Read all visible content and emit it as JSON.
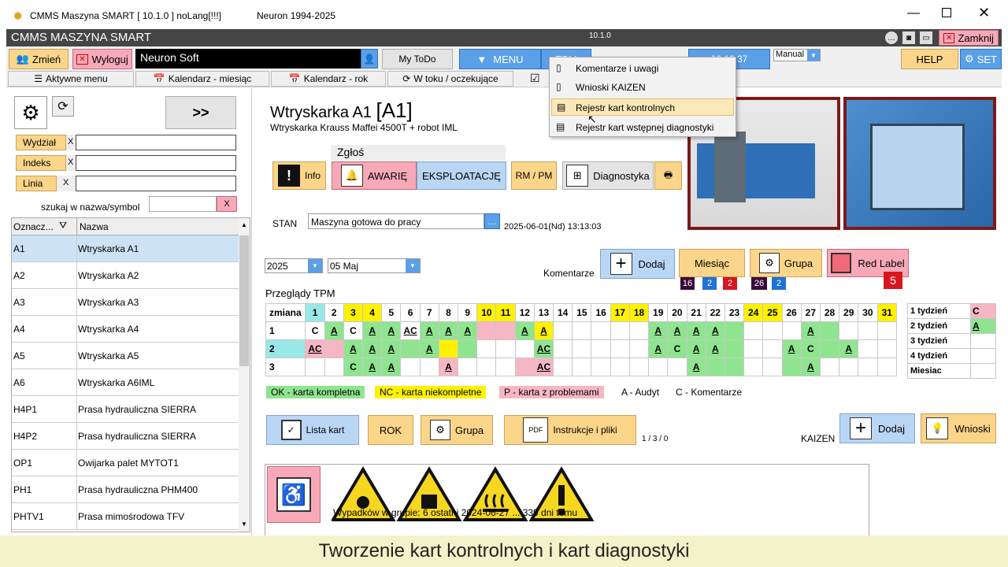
{
  "titlebar": {
    "title": "CMMS Maszyna SMART  [  10.1.0 ]  noLang[!!!]",
    "company": "Neuron 1994-2025"
  },
  "appbar": {
    "title": "CMMS MASZYNA SMART",
    "version": "10.1.0",
    "close": "Zamknij"
  },
  "toolbar": {
    "change": "Zmień",
    "logout": "Wyloguj",
    "user": "Neuron Soft",
    "mytodo": "My ToDo",
    "menu": "MENU",
    "tpm": "TPM",
    "time": "06:13:37",
    "mode": "Manual",
    "help": "HELP",
    "set": "SET"
  },
  "nav": {
    "active": "Aktywne menu",
    "cal_month": "Kalendarz - miesiąc",
    "cal_year": "Kalendarz - rok",
    "inprogress": "W toku / oczekujące"
  },
  "dropdown": {
    "items": [
      "Komentarze i uwagi",
      "Wnioski KAIZEN",
      "Rejestr kart kontrolnych",
      "Rejestr kart wstępnej diagnostyki"
    ]
  },
  "filters": {
    "arrow": ">>",
    "wydzial": "Wydział",
    "indeks": "Indeks",
    "linia": "Linia",
    "x": "X",
    "search_label": "szukaj w  nazwa/symbol"
  },
  "list": {
    "col1": "Oznacz...",
    "col2": "Nazwa",
    "rows": [
      {
        "id": "A1",
        "name": "Wtryskarka A1"
      },
      {
        "id": "A2",
        "name": "Wtryskarka A2"
      },
      {
        "id": "A3",
        "name": "Wtryskarka A3"
      },
      {
        "id": "A4",
        "name": "Wtryskarka A4"
      },
      {
        "id": "A5",
        "name": "Wtryskarka A5"
      },
      {
        "id": "A6",
        "name": "Wtryskarka A6IML"
      },
      {
        "id": "H4P1",
        "name": "Prasa hydrauliczna SIERRA"
      },
      {
        "id": "H4P2",
        "name": "Prasa hydrauliczna SIERRA"
      },
      {
        "id": "OP1",
        "name": "Owijarka palet MYTOT1"
      },
      {
        "id": "PH1",
        "name": "Prasa hydrauliczna PHM400"
      },
      {
        "id": "PHTV1",
        "name": "Prasa mimośrodowa TFV"
      }
    ]
  },
  "machine": {
    "title": "Wtryskarka A1",
    "code": "[A1]",
    "subtitle": "Wtryskarka Krauss Maffei 4500T + robot IML"
  },
  "actions": {
    "zglos": "Zgłoś",
    "info": "Info",
    "awarie": "AWARIĘ",
    "eksploatacje": "EKSPLOATACJĘ",
    "rmpm": "RM / PM",
    "diag": "Diagnostyka"
  },
  "status": {
    "label": "STAN",
    "value": "Maszyna gotowa do pracy",
    "datetime": "2025-06-01(Nd) 13:13:03"
  },
  "period": {
    "year": "2025",
    "month": "05  Maj",
    "comments": "Komentarze",
    "add": "Dodaj",
    "month_btn": "Miesiąc",
    "group": "Grupa",
    "redlabel": "Red Label",
    "badges": [
      "16",
      "2",
      "2",
      "26",
      "2",
      "5"
    ]
  },
  "tpm": {
    "title": "Przeglądy TPM",
    "header": "zmiana",
    "days": [
      "1",
      "2",
      "3",
      "4",
      "5",
      "6",
      "7",
      "8",
      "9",
      "10",
      "11",
      "12",
      "13",
      "14",
      "15",
      "16",
      "17",
      "18",
      "19",
      "20",
      "21",
      "22",
      "23",
      "24",
      "25",
      "26",
      "27",
      "28",
      "29",
      "30",
      "31"
    ],
    "rows": [
      {
        "label": "1",
        "cells": [
          "C",
          "A",
          "C",
          "A",
          "A",
          "AC",
          "A",
          "A",
          "A",
          "",
          "",
          "A",
          "A",
          "",
          "",
          "",
          "",
          "",
          "A",
          "A",
          "A",
          "A",
          "",
          "",
          "",
          "",
          "A",
          "",
          "",
          "",
          ""
        ]
      },
      {
        "label": "2",
        "cells": [
          "AC",
          "",
          "A",
          "A",
          "A",
          "",
          "A",
          "",
          "",
          "",
          "",
          "",
          "AC",
          "",
          "",
          "",
          "",
          "",
          "A",
          "C",
          "A",
          "A",
          "",
          "",
          "",
          "A",
          "C",
          "",
          "A",
          "",
          ""
        ]
      },
      {
        "label": "3",
        "cells": [
          "",
          "",
          "C",
          "A",
          "A",
          "",
          "",
          "A",
          "",
          "",
          "",
          "",
          "AC",
          "",
          "",
          "",
          "",
          "",
          "",
          "",
          "A",
          "",
          "",
          "",
          "",
          "",
          "A",
          "",
          "",
          "",
          ""
        ]
      }
    ]
  },
  "weeks": {
    "rows": [
      {
        "label": "1 tydzień",
        "val": "C"
      },
      {
        "label": "2 tydzień",
        "val": "A"
      },
      {
        "label": "3 tydzień",
        "val": ""
      },
      {
        "label": "4 tydzień",
        "val": ""
      },
      {
        "label": "Miesiac",
        "val": ""
      }
    ]
  },
  "legend": {
    "ok": "OK - karta kompletna",
    "nc": "NC - karta niekompletne",
    "p": "P - karta z problemami",
    "a": "A - Audyt",
    "c": "C - Komentarze"
  },
  "bottom": {
    "cards": "Lista kart",
    "rok": "ROK",
    "group": "Grupa",
    "instr": "Instrukcje i pliki",
    "count": "1 / 3 / 0",
    "kaizen": "KAIZEN",
    "add": "Dodaj",
    "wnioski": "Wnioski"
  },
  "safety": {
    "text": "Wypadków w grupie: 6  ostatni 2024-06-27 ... 339 dni temu"
  },
  "caption": "Tworzenie kart kontrolnych i kart diagnostyki"
}
